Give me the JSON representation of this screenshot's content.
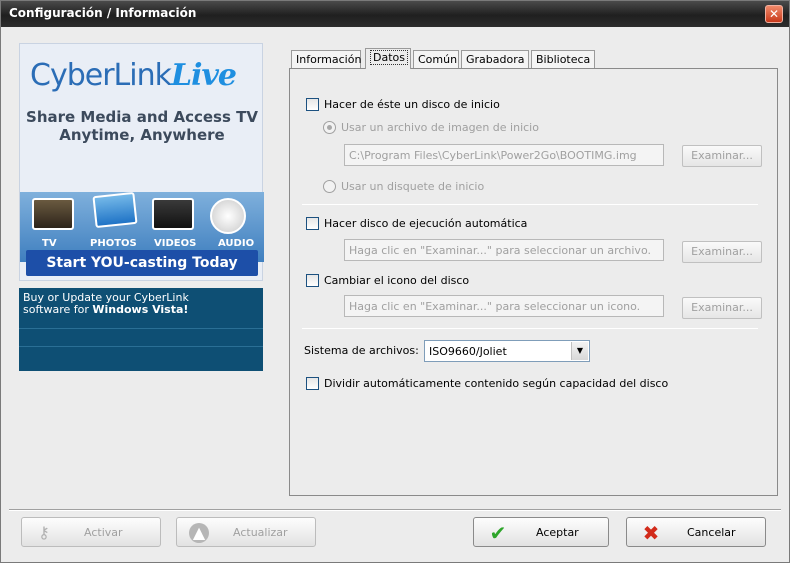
{
  "window": {
    "title": "Configuración / Información"
  },
  "ad": {
    "logo_text": "CyberLink",
    "logo_live": "Live",
    "tagline1": "Share Media and Access TV",
    "tagline2": "Anytime, Anywhere",
    "media_labels": [
      "TV",
      "PHOTOS",
      "VIDEOS",
      "AUDIO"
    ],
    "cta": "Start YOU-casting Today",
    "bottom_text1": "Buy or Update your CyberLink",
    "bottom_text2_prefix": "software for ",
    "bottom_text2_bold": "Windows Vista!"
  },
  "tabs": [
    {
      "label": "Información"
    },
    {
      "label": "Datos"
    },
    {
      "label": "Común"
    },
    {
      "label": "Grabadora"
    },
    {
      "label": "Biblioteca"
    }
  ],
  "active_tab": "Datos",
  "datos": {
    "boot_disc_label": "Hacer de éste un disco de inicio",
    "boot_image_radio": "Usar un archivo de imagen de inicio",
    "boot_image_path": "C:\\Program Files\\CyberLink\\Power2Go\\BOOTIMG.img",
    "boot_floppy_radio": "Usar un disquete de inicio",
    "autorun_label": "Hacer disco de ejecución automática",
    "autorun_placeholder": "Haga clic en \"Examinar...\" para seleccionar un archivo.",
    "icon_label": "Cambiar el icono del disco",
    "icon_placeholder": "Haga clic en \"Examinar...\" para seleccionar un icono.",
    "browse_label": "Examinar...",
    "filesystem_label": "Sistema de archivos:",
    "filesystem_value": "ISO9660/Joliet",
    "split_label": "Dividir automáticamente contenido según capacidad del disco"
  },
  "buttons": {
    "activar": "Activar",
    "actualizar": "Actualizar",
    "aceptar": "Aceptar",
    "cancelar": "Cancelar"
  },
  "colors": {
    "accent": "#1d4fa8",
    "ad_bottom": "#0e4f74",
    "check_green": "#2ea52a",
    "cancel_red": "#d22b1b"
  }
}
